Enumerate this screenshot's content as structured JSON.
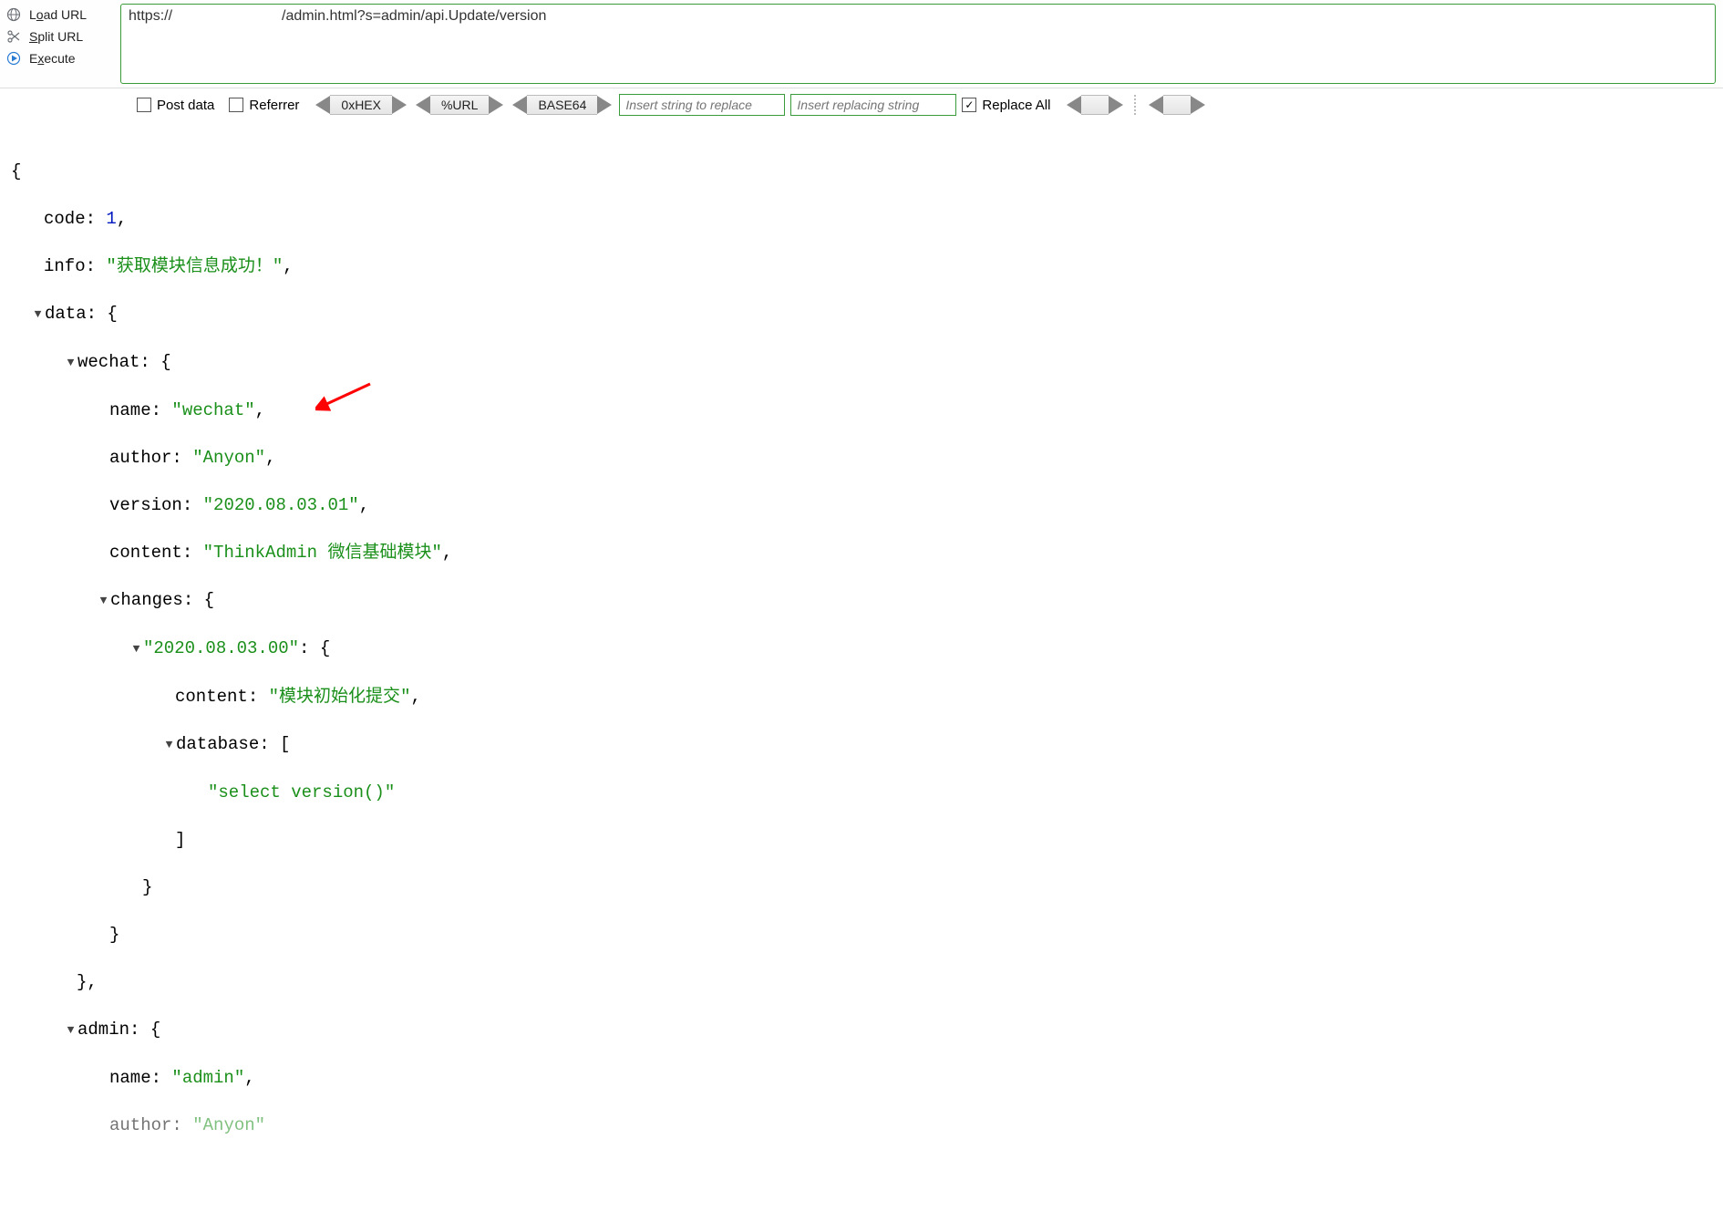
{
  "sideActions": {
    "load": {
      "label": "Load URL",
      "underline": "o"
    },
    "split": {
      "label": "Split URL",
      "underline": "S"
    },
    "execute": {
      "label": "Execute",
      "underline": "x"
    }
  },
  "url": {
    "prefix": "https://",
    "suffix": "/admin.html?s=admin/api.Update/version"
  },
  "toolbar": {
    "postData": "Post data",
    "referrer": "Referrer",
    "hex": "0xHEX",
    "urlenc": "%URL",
    "base64": "BASE64",
    "replaceSearchPH": "Insert string to replace",
    "replaceWithPH": "Insert replacing string",
    "replaceAll": "Replace All",
    "replaceAllChecked": true
  },
  "response": {
    "code": 1,
    "info": "获取模块信息成功！",
    "data": {
      "wechat": {
        "name": "wechat",
        "author": "Anyon",
        "version": "2020.08.03.01",
        "content": "ThinkAdmin 微信基础模块",
        "changes": {
          "2020.08.03.00": {
            "content": "模块初始化提交",
            "database": [
              "select version()"
            ]
          }
        }
      },
      "admin": {
        "name": "admin",
        "author": "Anyon"
      }
    }
  }
}
